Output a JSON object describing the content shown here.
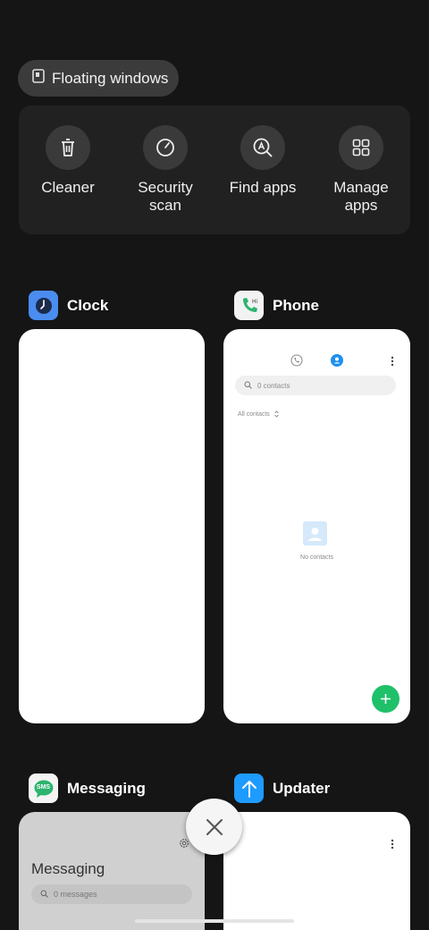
{
  "floating_windows": {
    "label": "Floating windows",
    "icon": "floating-window-icon"
  },
  "quick_actions": [
    {
      "label": "Cleaner",
      "icon": "trash-icon"
    },
    {
      "label": "Security\nscan",
      "icon": "gauge-icon"
    },
    {
      "label": "Find apps",
      "icon": "search-apps-icon"
    },
    {
      "label": "Manage\napps",
      "icon": "grid-icon"
    }
  ],
  "recent_apps": {
    "clock": {
      "name": "Clock",
      "icon": "clock-icon"
    },
    "phone": {
      "name": "Phone",
      "icon": "phone-icon",
      "search_placeholder": "0 contacts",
      "filter_label": "All contacts",
      "empty_label": "No contacts"
    },
    "messaging": {
      "name": "Messaging",
      "icon": "sms-icon",
      "icon_text": "SMS",
      "title": "Messaging",
      "search_placeholder": "0 messages"
    },
    "updater": {
      "name": "Updater",
      "icon": "arrow-up-icon"
    }
  },
  "colors": {
    "background": "#151515",
    "accent_green": "#1fc06a",
    "accent_blue": "#1e8ff0",
    "clock_icon_bg": "#4a8cf0",
    "updater_icon_bg": "#1e9bff"
  }
}
